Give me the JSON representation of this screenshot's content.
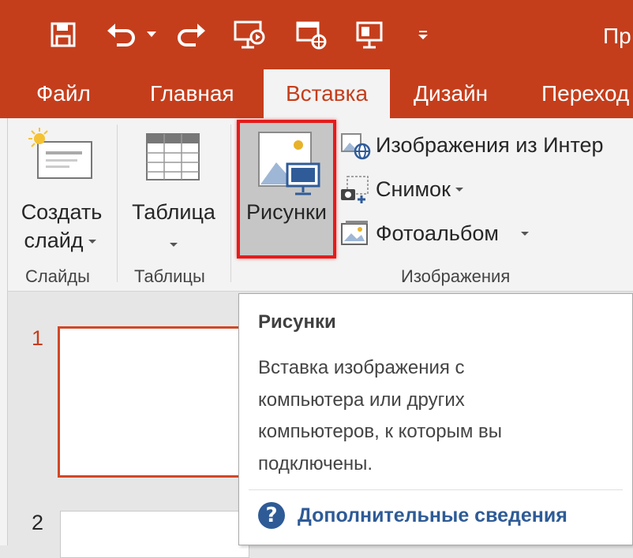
{
  "title_partial": "Пр",
  "quick_access": [
    "save-icon",
    "undo-icon",
    "undo-dropdown-icon",
    "redo-icon",
    "slideshow-icon",
    "present-online-icon",
    "monitor-icon",
    "customize-dropdown-icon"
  ],
  "tabs": [
    {
      "label": "Файл",
      "active": false
    },
    {
      "label": "Главная",
      "active": false
    },
    {
      "label": "Вставка",
      "active": true
    },
    {
      "label": "Дизайн",
      "active": false
    },
    {
      "label": "Переход",
      "active": false
    }
  ],
  "ribbon": {
    "slides_group": {
      "button_line1": "Создать",
      "button_line2": "слайд",
      "label": "Слайды"
    },
    "tables_group": {
      "button": "Таблица",
      "label": "Таблицы"
    },
    "images_group": {
      "pictures_button": "Рисунки",
      "online_pictures": "Изображения из Интер",
      "screenshot": "Снимок",
      "photo_album": "Фотоальбом",
      "label": "Изображения"
    }
  },
  "slides": [
    {
      "number": "1"
    },
    {
      "number": "2"
    }
  ],
  "tooltip": {
    "title": "Рисунки",
    "lines": [
      "Вставка изображения с",
      "компьютера или других",
      "компьютеров, к которым вы",
      "подключены."
    ],
    "help_icon": "?",
    "help": "Дополнительные сведения"
  },
  "colors": {
    "accent": "#c43e1c",
    "highlight_border": "#e41b1b",
    "link": "#2e5b96"
  }
}
